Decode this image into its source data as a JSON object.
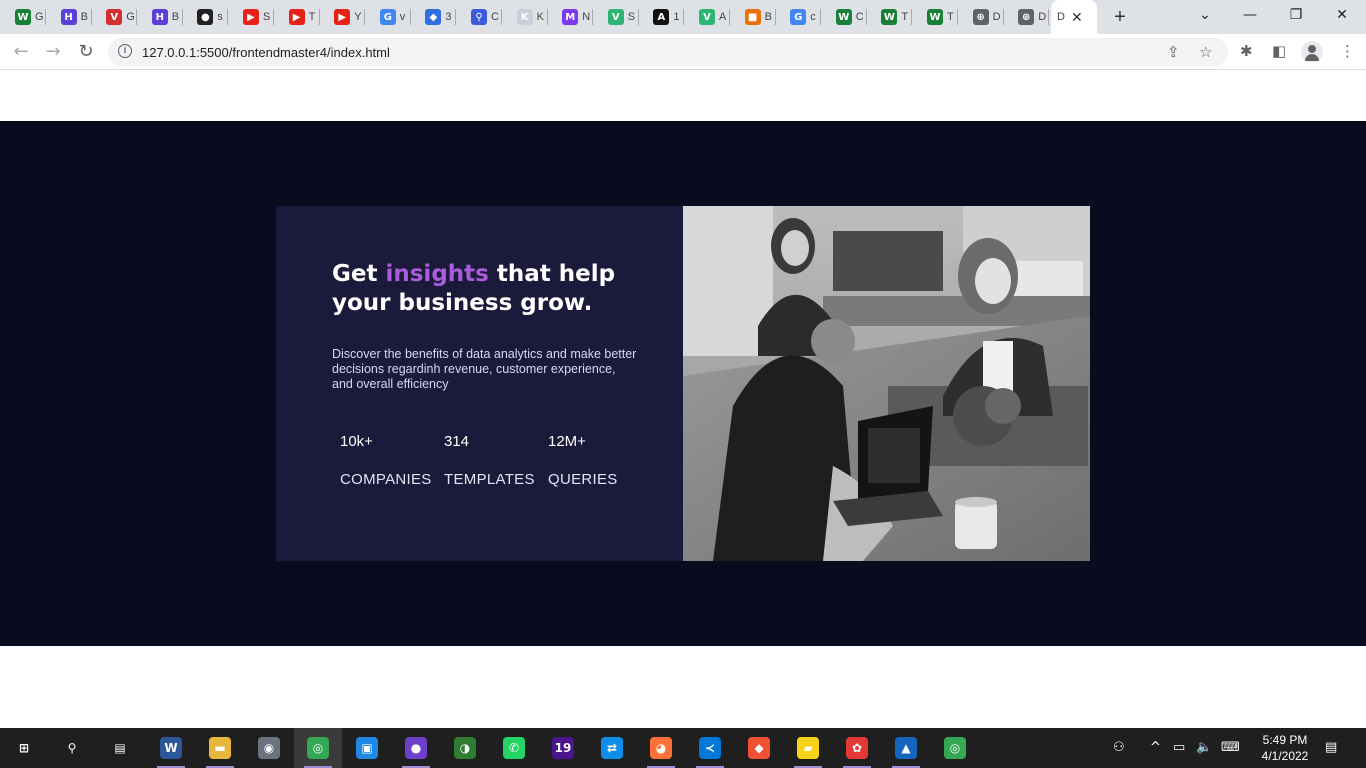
{
  "browser": {
    "tabs": [
      {
        "letter": "W",
        "title": "G",
        "color": "#1a7f37"
      },
      {
        "letter": "H",
        "title": "B",
        "color": "#5b3fd6"
      },
      {
        "letter": "V",
        "title": "G",
        "color": "#d32f2f"
      },
      {
        "letter": "H",
        "title": "B",
        "color": "#5b3fd6"
      },
      {
        "letter": "●",
        "title": "s",
        "color": "#222222"
      },
      {
        "letter": "▶",
        "title": "S",
        "color": "#e62117"
      },
      {
        "letter": "▶",
        "title": "T",
        "color": "#e62117"
      },
      {
        "letter": "▶",
        "title": "Y",
        "color": "#e62117"
      },
      {
        "letter": "G",
        "title": "v",
        "color": "#4285f4"
      },
      {
        "letter": "◆",
        "title": "3",
        "color": "#2f6fe0"
      },
      {
        "letter": "⚲",
        "title": "C",
        "color": "#3b5bdb"
      },
      {
        "letter": "K",
        "title": "K",
        "color": "#c9d0d9"
      },
      {
        "letter": "M",
        "title": "N",
        "color": "#7c3aed"
      },
      {
        "letter": "V",
        "title": "S",
        "color": "#2bb673"
      },
      {
        "letter": "A",
        "title": "1",
        "color": "#111111"
      },
      {
        "letter": "V",
        "title": "A",
        "color": "#2bb673"
      },
      {
        "letter": "■",
        "title": "B",
        "color": "#e8710a"
      },
      {
        "letter": "G",
        "title": "c",
        "color": "#4285f4"
      },
      {
        "letter": "W",
        "title": "C",
        "color": "#1a7f37"
      },
      {
        "letter": "W",
        "title": "T",
        "color": "#1a7f37"
      },
      {
        "letter": "W",
        "title": "T",
        "color": "#1a7f37"
      },
      {
        "letter": "⊕",
        "title": "D",
        "color": "#5f6368"
      },
      {
        "letter": "⊕",
        "title": "D",
        "color": "#5f6368"
      }
    ],
    "active_tab": {
      "title": "D",
      "close": "✕"
    },
    "new_tab": "+",
    "window_controls": {
      "dropdown": "⌄",
      "minimize": "—",
      "maximize": "❐",
      "close": "✕"
    },
    "nav": {
      "back": "←",
      "forward": "→",
      "reload": "↻"
    },
    "url": "127.0.0.1:5500/frontendmaster4/index.html",
    "info_icon": "i",
    "omnibox_icons": {
      "share": "⇪",
      "star": "☆"
    },
    "toolbar_icons": {
      "extensions": "✱",
      "sidepanel": "◧",
      "menu": "⋮"
    }
  },
  "hero": {
    "headline_part1": "Get ",
    "headline_accent": "insights",
    "headline_part2": " that help your business grow.",
    "description": "Discover the benefits of data analytics and make better decisions regardinh revenue, customer experience, and overall efficiency",
    "stats": [
      {
        "value": "10k+",
        "label": "COMPANIES"
      },
      {
        "value": "314",
        "label": "TEMPLATES"
      },
      {
        "value": "12M+",
        "label": "QUERIES"
      }
    ],
    "colors": {
      "section_bg": "#090b1f",
      "card_bg": "#1c1a3b",
      "accent": "#aa5cdb"
    }
  },
  "taskbar": {
    "apps": [
      {
        "name": "windows-start-icon",
        "glyph": "⊞",
        "color": "#1f1f1f"
      },
      {
        "name": "search-icon",
        "glyph": "⚲",
        "color": "#1f1f1f"
      },
      {
        "name": "task-view-icon",
        "glyph": "▤",
        "color": "#1f1f1f"
      },
      {
        "name": "word-icon",
        "glyph": "W",
        "color": "#2b579a"
      },
      {
        "name": "file-explorer-icon",
        "glyph": "▬",
        "color": "#e8b63a"
      },
      {
        "name": "camera-icon",
        "glyph": "◉",
        "color": "#6b7280"
      },
      {
        "name": "chrome-icon",
        "glyph": "◎",
        "color": "#34a853"
      },
      {
        "name": "app-icon",
        "glyph": "▣",
        "color": "#1e88e5"
      },
      {
        "name": "github-desktop-icon",
        "glyph": "●",
        "color": "#6e40c9"
      },
      {
        "name": "app-icon",
        "glyph": "◑",
        "color": "#2e7d32"
      },
      {
        "name": "whatsapp-icon",
        "glyph": "✆",
        "color": "#25d366"
      },
      {
        "name": "app-icon",
        "glyph": "19",
        "color": "#4a148c"
      },
      {
        "name": "teamviewer-icon",
        "glyph": "⇄",
        "color": "#0e8ee9"
      },
      {
        "name": "firefox-icon",
        "glyph": "◕",
        "color": "#ff7139"
      },
      {
        "name": "vscode-icon",
        "glyph": "≺",
        "color": "#0078d7"
      },
      {
        "name": "git-icon",
        "glyph": "◆",
        "color": "#f05033"
      },
      {
        "name": "sticky-notes-icon",
        "glyph": "▰",
        "color": "#f7d21a"
      },
      {
        "name": "app-icon",
        "glyph": "✿",
        "color": "#e53935"
      },
      {
        "name": "photos-icon",
        "glyph": "▲",
        "color": "#1565c0"
      },
      {
        "name": "chrome-icon",
        "glyph": "◎",
        "color": "#34a853"
      }
    ],
    "tray": {
      "people": "⚇",
      "chevron": "^",
      "battery": "▭",
      "volume": "🔈",
      "keyboard": "⌨",
      "notifications": "▤"
    },
    "time": "5:49 PM",
    "date": "4/1/2022"
  }
}
